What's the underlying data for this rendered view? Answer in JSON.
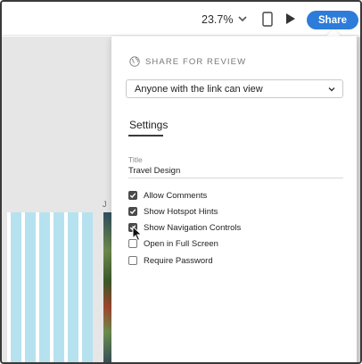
{
  "toolbar": {
    "zoom_value": "23.7%",
    "share_label": "Share",
    "icons": [
      "chevron-down-icon",
      "phone-preview-icon",
      "play-icon"
    ]
  },
  "canvas": {
    "artboard_label": "J"
  },
  "share_panel": {
    "heading": "SHARE FOR REVIEW",
    "heading_icon": "globe-icon",
    "access_select": "Anyone with the link can view",
    "settings_tab": "Settings",
    "title_label": "Title",
    "title_value": "Travel Design",
    "options": [
      {
        "label": "Allow Comments",
        "checked": true
      },
      {
        "label": "Show Hotspot Hints",
        "checked": true
      },
      {
        "label": "Show Navigation Controls",
        "checked": true
      },
      {
        "label": "Open in Full Screen",
        "checked": false
      },
      {
        "label": "Require Password",
        "checked": false
      }
    ]
  },
  "colors": {
    "accent": "#2d7cd9",
    "canvas_bg": "#e6e6e6",
    "grid_column": "#b6e2ef",
    "checkbox_checked": "#4a4a4a"
  }
}
